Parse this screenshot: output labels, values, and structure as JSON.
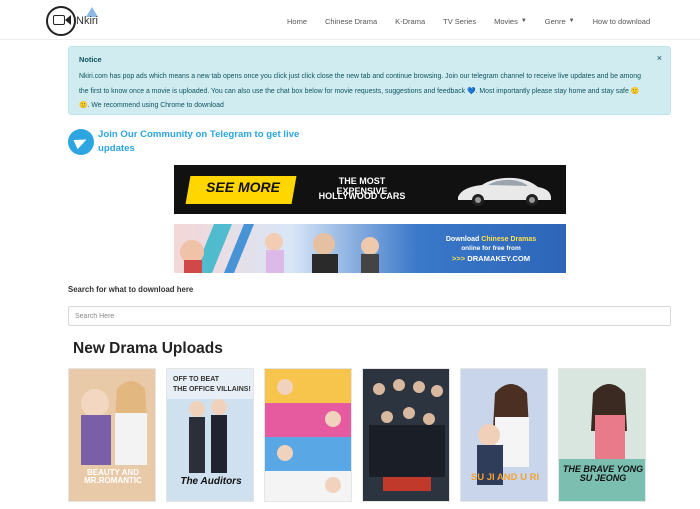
{
  "header": {
    "logo_text": "Nkiri",
    "nav": [
      {
        "label": "Home",
        "caret": false
      },
      {
        "label": "Chinese Drama",
        "caret": false
      },
      {
        "label": "K-Drama",
        "caret": false
      },
      {
        "label": "TV Series",
        "caret": false
      },
      {
        "label": "Movies",
        "caret": true
      },
      {
        "label": "Genre",
        "caret": true
      },
      {
        "label": "How to download",
        "caret": false
      }
    ]
  },
  "notice": {
    "title": "Notice",
    "body": "Nkiri.com has pop ads which means a new tab opens once you click just click close the new tab and continue browsing. Join our telegram channel to receive live updates and be among the first to know once a movie is uploaded. You can also use the chat box below for movie requests, suggestions and feedback 💙. Most importantly please stay home and stay safe 🙂🙂. We recommend using Chrome to download",
    "close": "×"
  },
  "telegram": {
    "text": "Join Our Community on Telegram to get live updates"
  },
  "ads": {
    "ad1": {
      "cta": "SEE MORE",
      "line1": "THE MOST EXPENSIVE",
      "line2": "HOLLYWOOD CARS"
    },
    "ad2": {
      "line1_prefix": "Download",
      "line1_highlight": "Chinese Dramas",
      "line2": "online for free from",
      "arrows": ">>>",
      "site": "DRAMAKEY.COM"
    }
  },
  "search": {
    "label": "Search for what to download here",
    "placeholder": "Search Here"
  },
  "section": {
    "title": "New Drama Uploads"
  },
  "posters": [
    {
      "title": "BEAUTY AND MR.ROMANTIC",
      "bg": "#e8c9a8"
    },
    {
      "title": "The Auditors",
      "bg": "#cfe0ef"
    },
    {
      "title": "",
      "bg": "#8b5fb7"
    },
    {
      "title": "",
      "bg": "#2c3440"
    },
    {
      "title": "SU JI AND U RI",
      "bg": "#c9d5ea"
    },
    {
      "title": "THE BRAVE YONG SU JEONG",
      "bg": "#d9e6df"
    }
  ]
}
